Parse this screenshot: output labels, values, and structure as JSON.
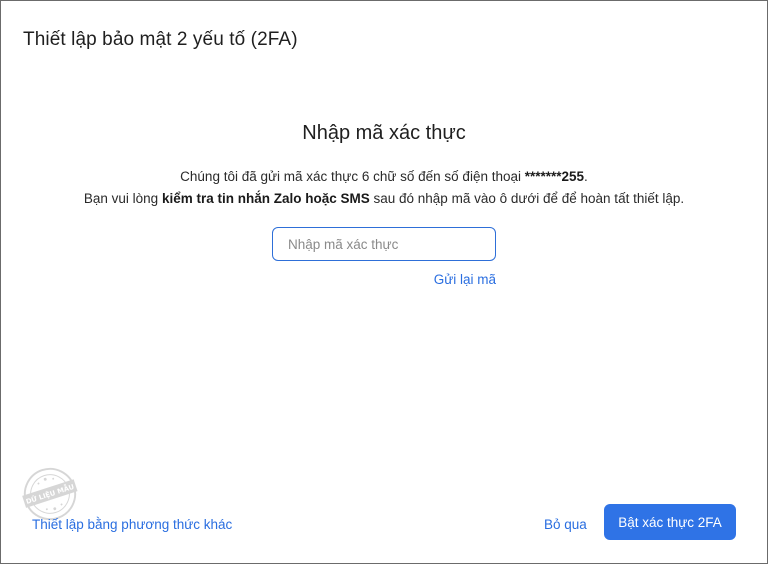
{
  "dialog": {
    "title": "Thiết lập bảo mật 2 yếu tố (2FA)"
  },
  "verify": {
    "heading": "Nhập mã xác thực",
    "line1_prefix": "Chúng tôi đã gửi mã xác thực 6 chữ số đến số điện thoại ",
    "masked_phone": "*******255",
    "line1_suffix": ".",
    "line2_prefix": "Bạn vui lòng ",
    "line2_bold": "kiểm tra tin nhắn Zalo hoặc SMS",
    "line2_suffix": " sau đó nhập mã vào ô dưới để để hoàn tất thiết lập.",
    "input_value": "",
    "input_placeholder": "Nhập mã xác thực",
    "resend_label": "Gửi lại mã"
  },
  "watermark": {
    "text": "DỮ LIỆU MẪU"
  },
  "footer": {
    "other_method_label": "Thiết lập bằng phương thức khác",
    "skip_label": "Bỏ qua",
    "enable_label": "Bật xác thực 2FA"
  },
  "colors": {
    "accent": "#2f73e6",
    "link": "#2a6ee0",
    "input_border": "#2e6fd8"
  }
}
